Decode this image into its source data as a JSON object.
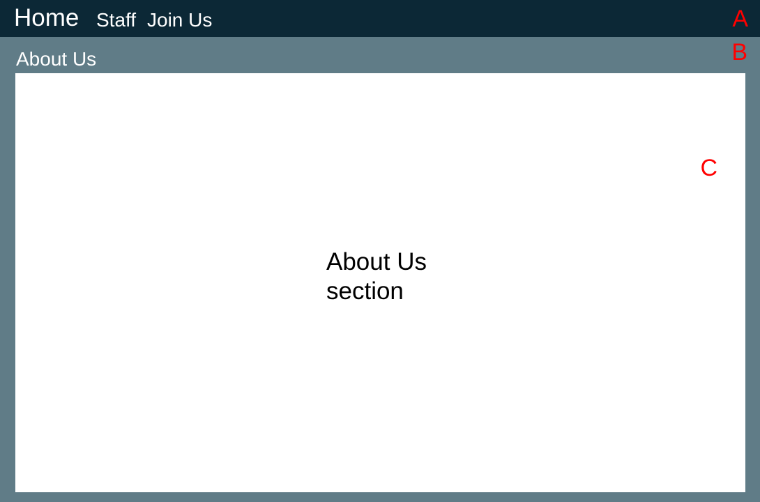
{
  "nav": {
    "home": "Home",
    "staff": "Staff",
    "join_us": "Join Us"
  },
  "markers": {
    "a": "A",
    "b": "B",
    "c": "C"
  },
  "section": {
    "heading": "About Us",
    "content_text": "About Us section"
  },
  "colors": {
    "topbar_background": "#0c2836",
    "page_background": "#607c87",
    "panel_background": "#ffffff",
    "marker_color": "#ff0000"
  }
}
